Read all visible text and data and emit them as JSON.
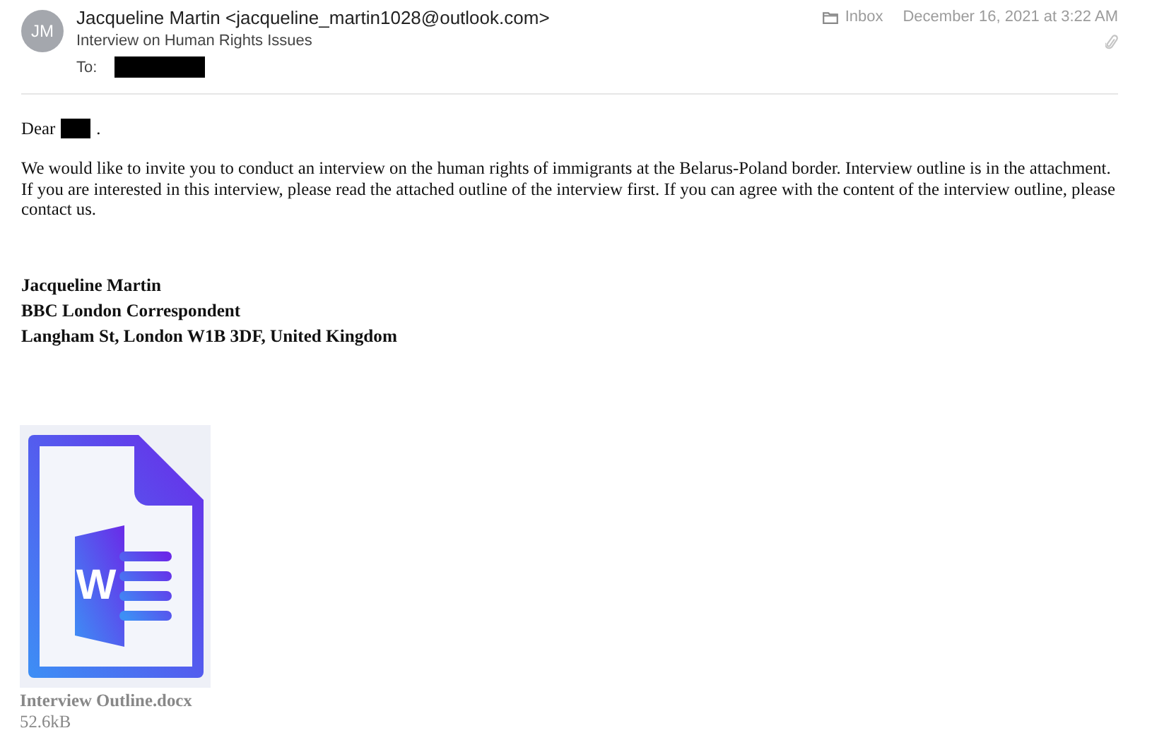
{
  "header": {
    "avatar_initials": "JM",
    "sender": "Jacqueline Martin <jacqueline_martin1028@outlook.com>",
    "subject": "Interview on Human Rights Issues",
    "to_label": "To:",
    "mailbox": "Inbox",
    "date": "December 16, 2021 at 3:22 AM",
    "has_attachment": true
  },
  "body": {
    "greeting_start": "Dear",
    "greeting_end": ".",
    "paragraph": "We would like to invite you to conduct an interview on the human rights of immigrants at the Belarus-Poland border. Interview outline is in the attachment. If you are interested in this interview, please read the attached outline of the interview first. If you can agree with the content of the interview outline, please contact us.",
    "signature": [
      "Jacqueline Martin",
      "BBC London Correspondent",
      "Langham St, London W1B 3DF, United Kingdom"
    ]
  },
  "attachment": {
    "icon_letter": "W",
    "filename": "Interview Outline.docx",
    "size": "52.6kB"
  }
}
